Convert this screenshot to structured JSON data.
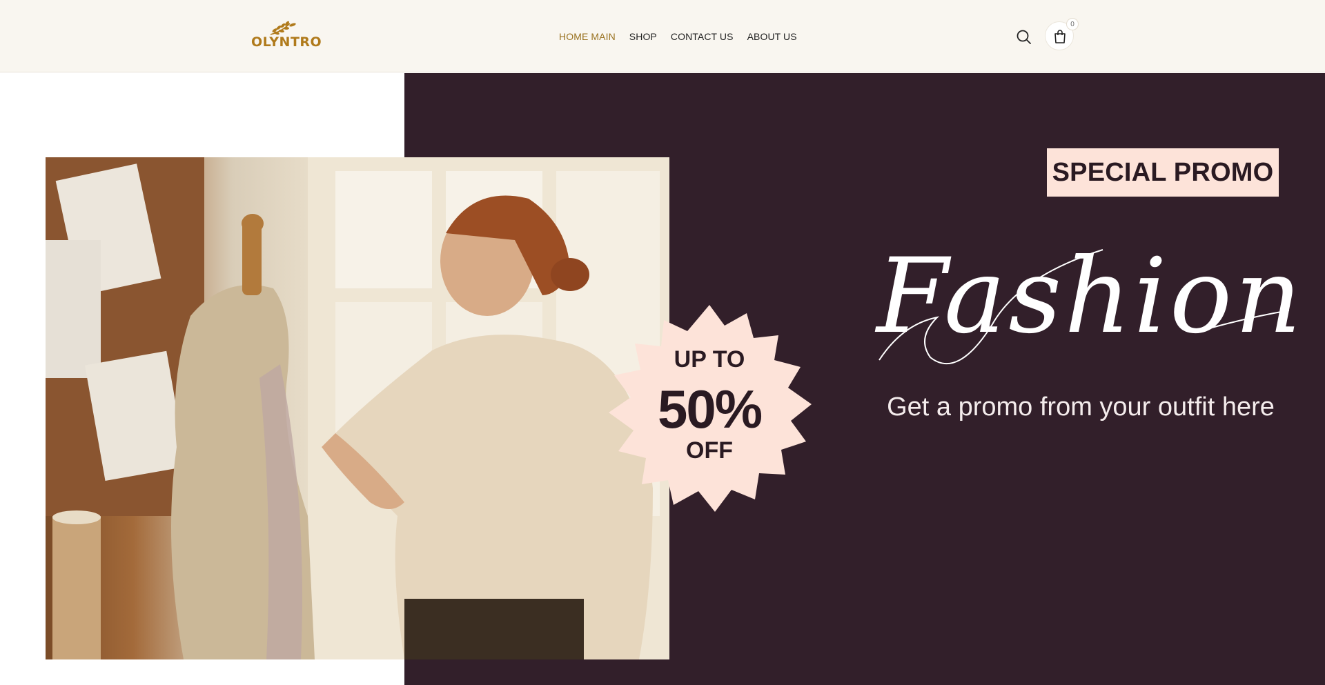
{
  "header": {
    "logo_text": "OLYNTRO",
    "nav": [
      {
        "label": "HOME MAIN",
        "active": true
      },
      {
        "label": "SHOP",
        "active": false
      },
      {
        "label": "CONTACT US",
        "active": false
      },
      {
        "label": "ABOUT US",
        "active": false
      }
    ],
    "search_icon": "search-icon",
    "cart_icon": "shopping-bag-icon",
    "cart_count": "0"
  },
  "hero": {
    "tag": "SPECIAL PROMO",
    "title": "Fashion",
    "subtitle": "Get a promo from your outfit here",
    "badge": {
      "line1": "UP TO",
      "value": "50%",
      "line3": "OFF"
    },
    "image": "woman-tailor-pinning-fabric-on-dress-mannequin"
  },
  "colors": {
    "header_bg": "#f9f6f0",
    "logo_gold": "#b07a1b",
    "nav_active": "#9a7322",
    "hero_bg": "#321f2a",
    "promo_pink": "#fde3d9"
  }
}
